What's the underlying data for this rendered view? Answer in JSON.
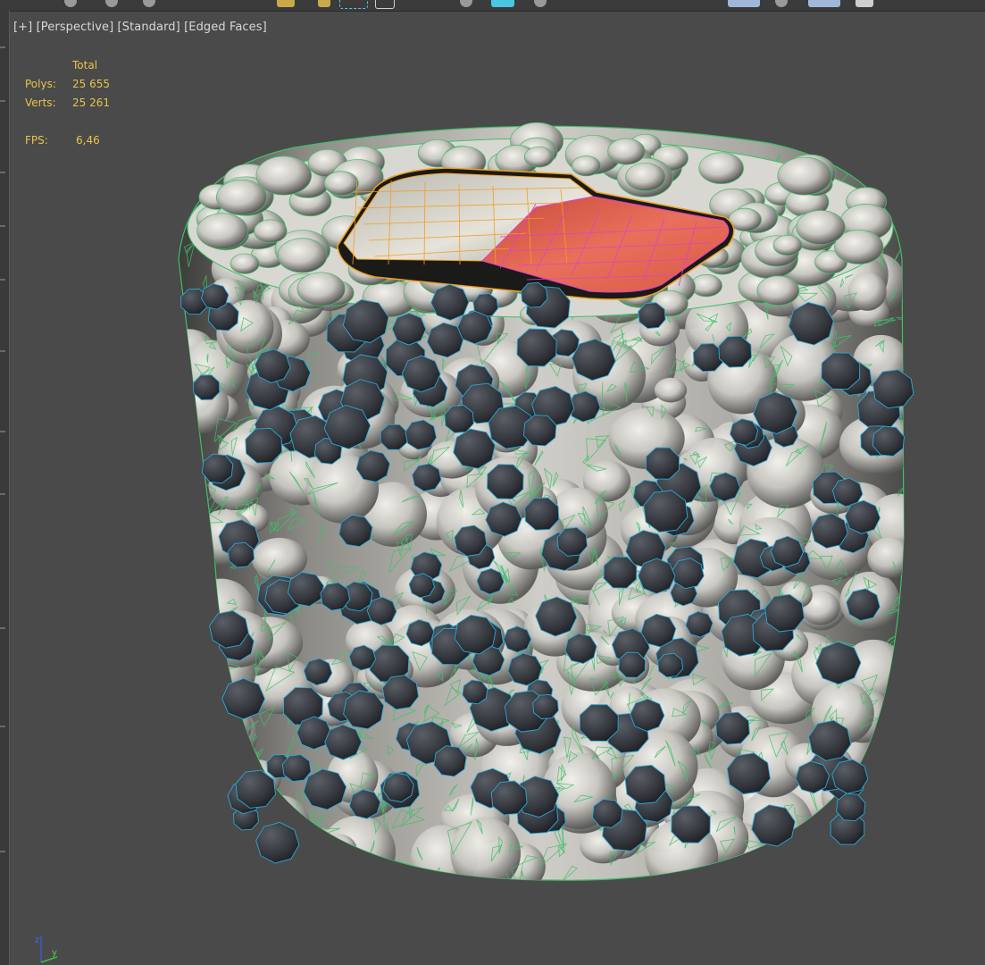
{
  "viewport": {
    "label": {
      "plus": "[+]",
      "view": "[Perspective]",
      "shading": "[Standard]",
      "mode": "[Edged Faces]"
    },
    "stats": {
      "header": "Total",
      "polys_label": "Polys:",
      "polys_value": "25 655",
      "verts_label": "Verts:",
      "verts_value": "25 261",
      "fps_label": "FPS:",
      "fps_value": "6,46"
    },
    "axis": {
      "z": "z",
      "y": "y"
    }
  },
  "colors": {
    "viewport_bg": "#4a4a4a",
    "stats_text": "#e8c44a",
    "label_text": "#d8d8d8",
    "rice": "#d8d6d0",
    "rice_wire": "#3fbf6a",
    "seeds": "#3a3d42",
    "seed_wire": "#2aa9d8",
    "salmon": "#e06048",
    "salmon_wire": "#e23fc8",
    "fish_selected_wire": "#f0a020"
  },
  "icons": [
    "move-icon",
    "select-region-icon",
    "viewport-layout-icon",
    "axis-gizmo-icon"
  ]
}
